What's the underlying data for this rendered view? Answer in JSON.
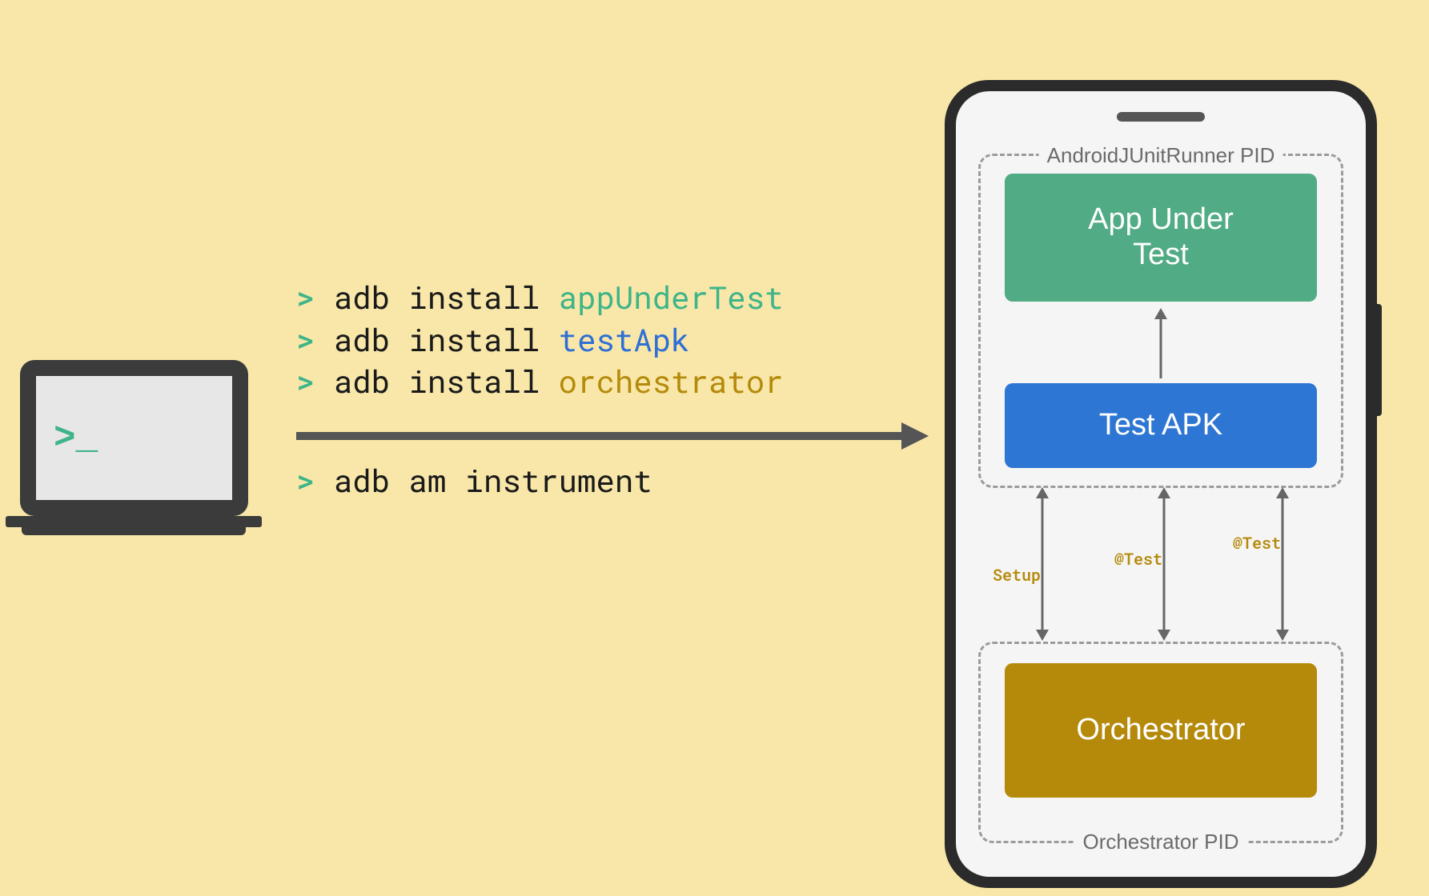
{
  "laptop": {
    "prompt": ">_"
  },
  "commands": [
    {
      "prompt": ">",
      "cmd": "adb install",
      "arg": "appUnderTest",
      "argClass": "arg-green"
    },
    {
      "prompt": ">",
      "cmd": "adb install",
      "arg": "testApk",
      "argClass": "arg-blue"
    },
    {
      "prompt": ">",
      "cmd": "adb install",
      "arg": "orchestrator",
      "argClass": "arg-gold"
    }
  ],
  "run": {
    "prompt": ">",
    "cmd": "adb am instrument"
  },
  "phone": {
    "top_pid_label": "AndroidJUnitRunner PID",
    "bottom_pid_label": "Orchestrator PID",
    "block_app": "App Under\nTest",
    "block_test": "Test APK",
    "block_orch": "Orchestrator",
    "arrow_labels": [
      "Setup",
      "@Test",
      "@Test"
    ]
  }
}
